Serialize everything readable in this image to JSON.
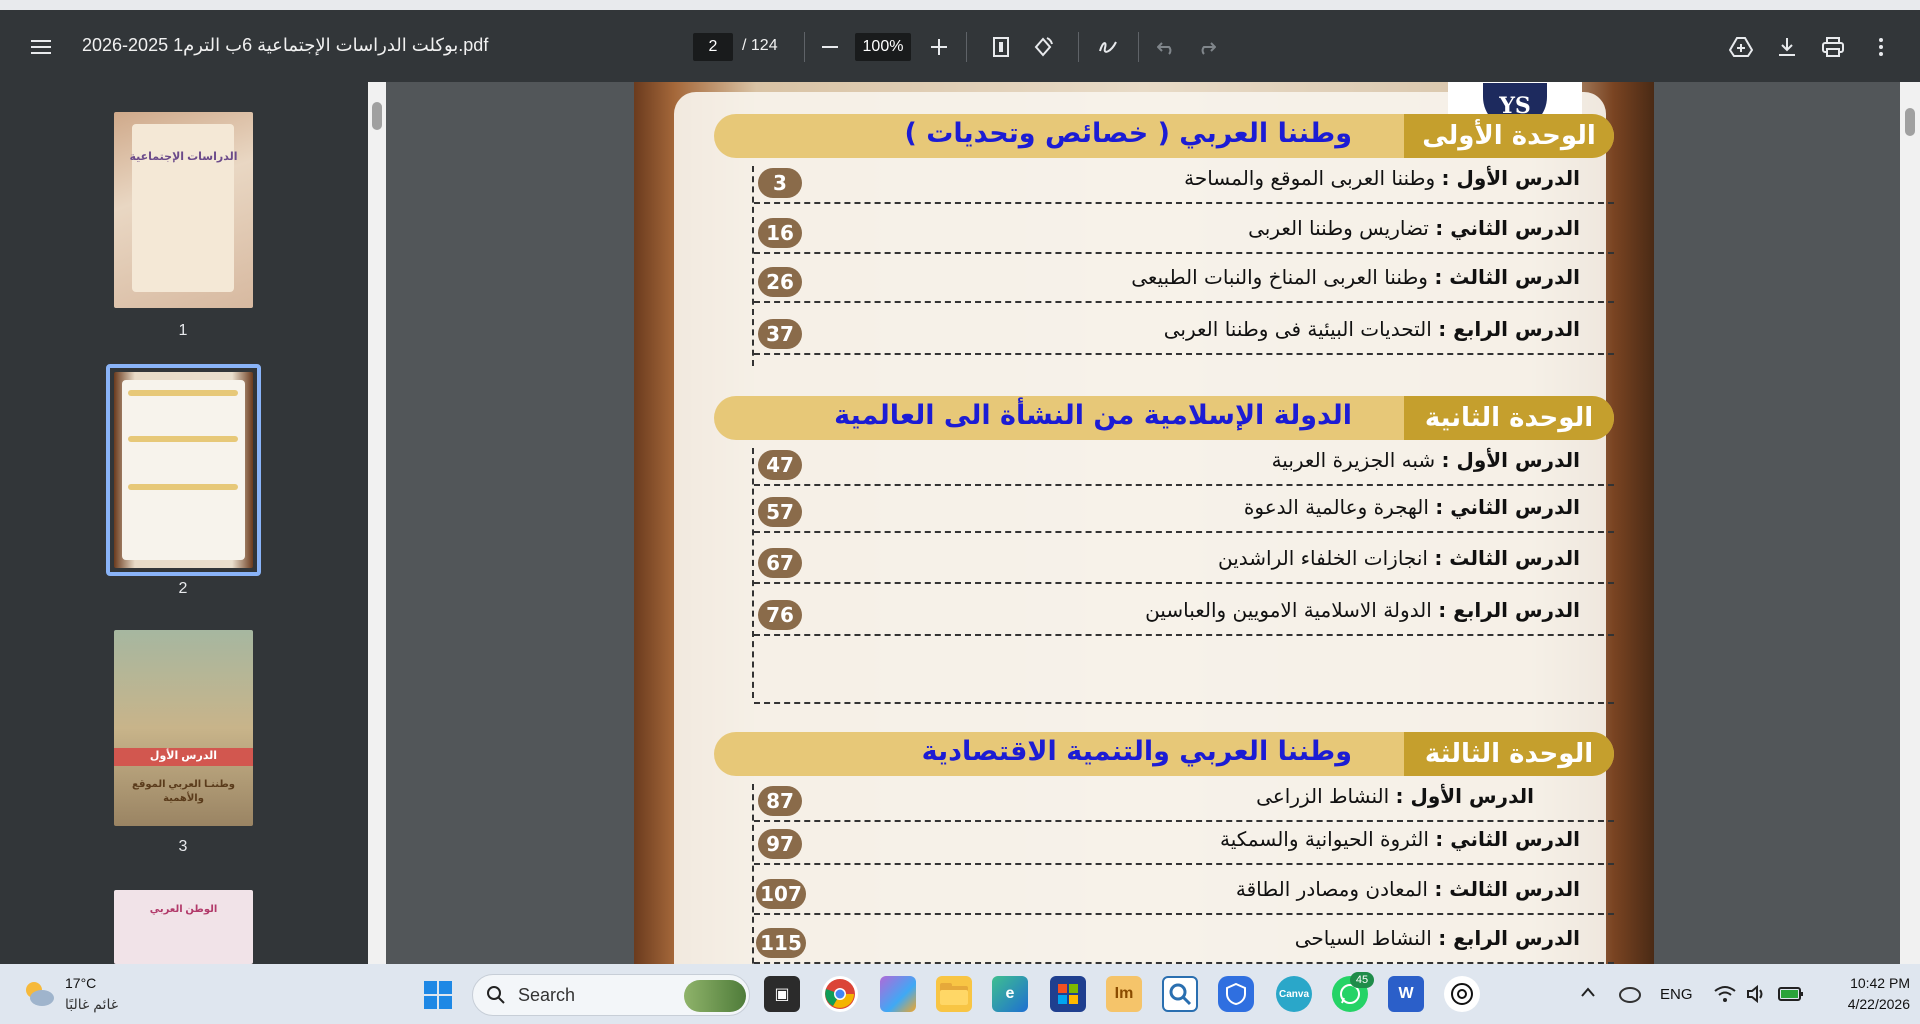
{
  "toolbar": {
    "file_title": "بوكلت الدراسات الإجتماعية 6ب الترم1 2025-2026.pdf",
    "current_page": "2",
    "total_pages": "/ 124",
    "zoom": "100%"
  },
  "sidebar": {
    "thumbnails": [
      {
        "num": "1",
        "title": "الدراسات الإجتماعية"
      },
      {
        "num": "2"
      },
      {
        "num": "3",
        "title": "الدرس الأول",
        "subtitle": "وطننـا العربي الموقع والأهمية"
      },
      {
        "num": "",
        "title": "الوطن العربي"
      }
    ]
  },
  "document": {
    "logo_text": "YS",
    "units": [
      {
        "tag": "الوحدة الأولى",
        "title": "وطننا العربي ( خصائص وتحديات )",
        "lessons": [
          {
            "label": "الدرس الأول :",
            "text": "وطننا العربى الموقع والمساحة",
            "page": "3"
          },
          {
            "label": "الدرس الثاني :",
            "text": "تضاريس وطننا العربى",
            "page": "16"
          },
          {
            "label": "الدرس الثالث :",
            "text": "وطننا العربى المناخ والنبات الطبيعى",
            "page": "26"
          },
          {
            "label": "الدرس الرابع :",
            "text": "التحديات البيئية فى وطننا العربى",
            "page": "37"
          }
        ]
      },
      {
        "tag": "الوحدة الثانية",
        "title": "الدولة الإسلامية من النشأة الى العالمية",
        "lessons": [
          {
            "label": "الدرس الأول :",
            "text": "شبه الجزيرة العربية",
            "page": "47"
          },
          {
            "label": "الدرس الثاني :",
            "text": "الهجرة وعالمية الدعوة",
            "page": "57"
          },
          {
            "label": "الدرس الثالث :",
            "text": "انجازات الخلفاء الراشدين",
            "page": "67"
          },
          {
            "label": "الدرس الرابع :",
            "text": "الدولة الاسلامية الامويين والعباسين",
            "page": "76"
          }
        ]
      },
      {
        "tag": "الوحدة الثالثة",
        "title": "وطننا العربي والتنمية الاقتصادية",
        "lessons": [
          {
            "label": "الدرس الأول :",
            "text": "النشاط الزراعى",
            "page": "87"
          },
          {
            "label": "الدرس الثاني :",
            "text": "الثروة الحيوانية والسمكية",
            "page": "97"
          },
          {
            "label": "الدرس الثالث :",
            "text": "المعادن ومصادر الطاقة",
            "page": "107"
          },
          {
            "label": "الدرس الرابع :",
            "text": "النشاط السياحى",
            "page": "115"
          }
        ]
      }
    ]
  },
  "taskbar": {
    "weather_temp": "17°C",
    "weather_desc": "غائم غالبًا",
    "search_label": "Search",
    "whatsapp_badge": "45",
    "lang": "ENG",
    "time": "10:42 PM",
    "date": "4/22/2026"
  },
  "colors": {
    "toolbar_bg": "#323639",
    "unit_bar": "#e7c878",
    "unit_tag": "#c59f2d",
    "unit_title": "#1c1cd4",
    "page_badge": "#8a6b4a",
    "selection": "#8ab4f8"
  }
}
